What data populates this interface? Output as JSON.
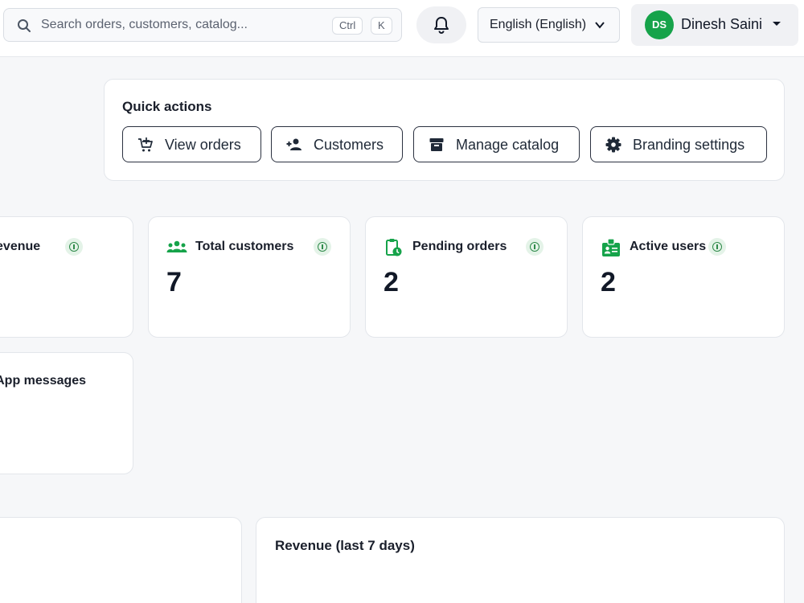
{
  "header": {
    "search": {
      "placeholder": "Search orders, customers, catalog...",
      "shortcut_ctrl": "Ctrl",
      "shortcut_key": "K"
    },
    "language": "English (English)",
    "user": {
      "initials": "DS",
      "name": "Dinesh Saini"
    }
  },
  "quick_actions": {
    "title": "Quick actions",
    "buttons": [
      {
        "label": "View orders",
        "icon": "cart-icon"
      },
      {
        "label": "Customers",
        "icon": "add-person-icon"
      },
      {
        "label": "Manage catalog",
        "icon": "archive-icon"
      },
      {
        "label": "Branding settings",
        "icon": "gear-icon"
      }
    ]
  },
  "stats": [
    {
      "label": "Total revenue",
      "visible_label": "al revenue",
      "value": ""
    },
    {
      "label": "Total customers",
      "value": "7",
      "icon": "group-icon"
    },
    {
      "label": "Pending orders",
      "value": "2",
      "icon": "clipboard-clock-icon"
    },
    {
      "label": "Active users",
      "value": "2",
      "icon": "id-badge-icon"
    },
    {
      "label": "atsApp messages",
      "visible_label": "atsApp messages",
      "value": ""
    }
  ],
  "charts": {
    "revenue_title": "Revenue (last 7 days)"
  },
  "colors": {
    "accent": "#16a34a",
    "info_bg": "#e4f3e8"
  }
}
